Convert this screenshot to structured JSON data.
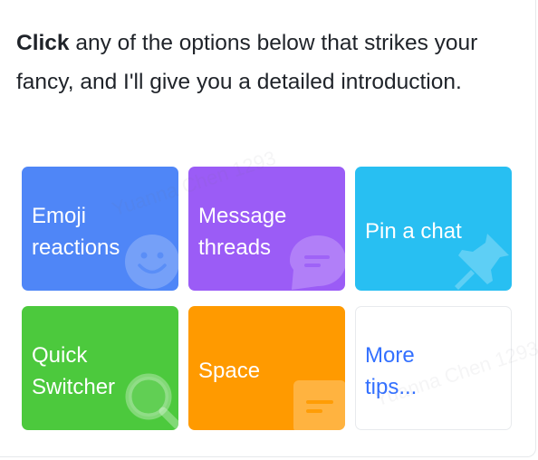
{
  "intro": {
    "bold": "Click",
    "text": " any of the options below that strikes your fancy, and I'll give you a detailed introduction."
  },
  "tiles": [
    {
      "label": "Emoji\nreactions",
      "color": "#4f86f7",
      "icon": "smiley-face-icon"
    },
    {
      "label": "Message\nthreads",
      "color": "#9b5cf6",
      "icon": "chat-bubble-icon"
    },
    {
      "label": "Pin a chat",
      "color": "#28bff2",
      "icon": "pushpin-icon"
    },
    {
      "label": "Quick\nSwitcher",
      "color": "#4cc93d",
      "icon": "magnifier-icon"
    },
    {
      "label": "Space",
      "color": "#ff9a00",
      "icon": "document-icon"
    },
    {
      "label": "More\ntips...",
      "color": "#ffffff",
      "text_color": "#3370ff"
    }
  ],
  "watermark": "Yuanna Chen 1293"
}
